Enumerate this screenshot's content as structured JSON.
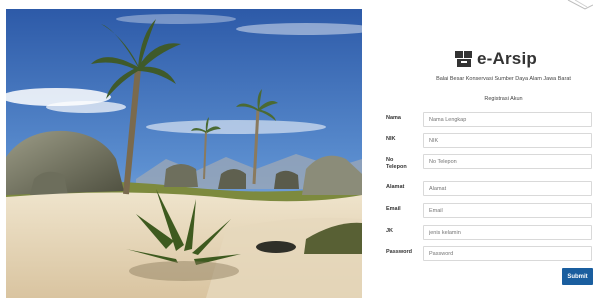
{
  "hero": {
    "image_name": "tropical-beach-illustration"
  },
  "brand": {
    "icon": "archive-box-icon",
    "title": "e-Arsip"
  },
  "organization": "Balai Besar Konservasi Sumber Daya Alam Jawa Barat",
  "form": {
    "title": "Registrasi Akun",
    "fields": [
      {
        "label": "Nama",
        "placeholder": "Nama Lengkap"
      },
      {
        "label": "NIK",
        "placeholder": "NIK"
      },
      {
        "label": "No Telepon",
        "placeholder": "No Telepon"
      },
      {
        "label": "Alamat",
        "placeholder": "Alamat"
      },
      {
        "label": "Email",
        "placeholder": "Email"
      },
      {
        "label": "JK",
        "placeholder": "jenis kelamin"
      },
      {
        "label": "Password",
        "placeholder": "Password"
      }
    ],
    "submit_label": "Submit"
  },
  "colors": {
    "accent": "#1a5e9f",
    "border": "#d9d9d9"
  }
}
